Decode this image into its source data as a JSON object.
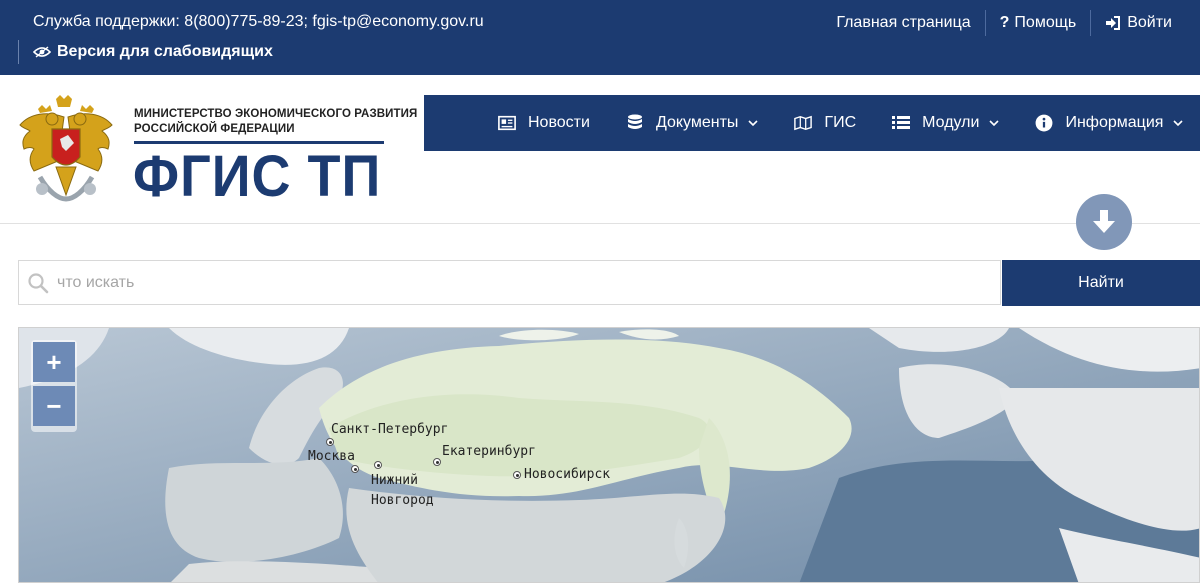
{
  "topbar": {
    "support_text": "Служба поддержки: 8(800)775-89-23; fgis-tp@economy.gov.ru",
    "accessible_label": "Версия для слабовидящих",
    "links": {
      "home": "Главная страница",
      "help": "Помощь",
      "login": "Войти"
    }
  },
  "header": {
    "ministry_line1": "МИНИСТЕРСТВО ЭКОНОМИЧЕСКОГО РАЗВИТИЯ",
    "ministry_line2": "РОССИЙСКОЙ ФЕДЕРАЦИИ",
    "brand": "ФГИС ТП"
  },
  "nav": {
    "news": "Новости",
    "documents": "Документы",
    "gis": "ГИС",
    "modules": "Модули",
    "info": "Информация"
  },
  "search": {
    "placeholder": "что искать",
    "button": "Найти"
  },
  "map": {
    "zoom_in": "+",
    "zoom_out": "−",
    "cities": {
      "spb": "Санкт-Петербург",
      "moscow": "Москва",
      "nn_line1": "Нижний",
      "nn_line2": "Новгород",
      "ekb": "Екатеринбург",
      "nsk": "Новосибирск"
    }
  },
  "colors": {
    "brand_blue": "#1c3b71",
    "download_button": "#8197b8",
    "zoom_button": "#6d8ab6"
  }
}
